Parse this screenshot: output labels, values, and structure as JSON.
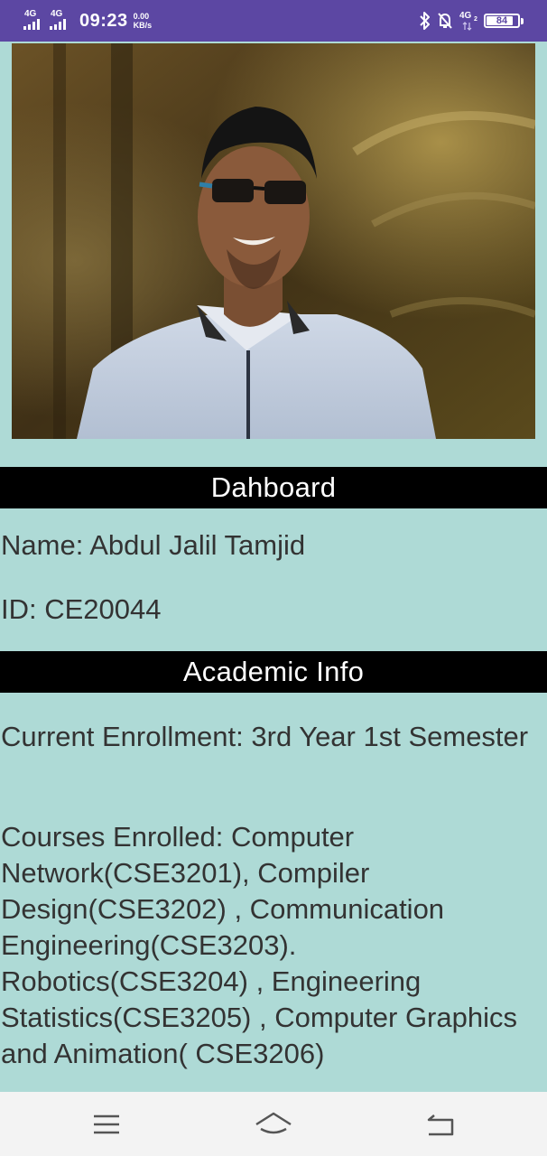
{
  "status_bar": {
    "network_left_1": "4G",
    "network_left_2": "4G",
    "time": "09:23",
    "speed_value": "0.00",
    "speed_unit": "KB/s",
    "network_right": "4G",
    "network_right_sub": "2",
    "battery_level": "84",
    "icons": [
      "signal-icon",
      "bluetooth-icon",
      "mute-notification-icon",
      "battery-icon"
    ]
  },
  "profile_photo": {
    "icon": "profile-photo"
  },
  "dashboard": {
    "title": "Dahboard",
    "name_line": "Name: Abdul Jalil Tamjid",
    "id_line": "ID: CE20044"
  },
  "academic": {
    "title": "Academic Info",
    "enrollment_line": "Current Enrollment: 3rd Year 1st Semester",
    "courses_line": "Courses Enrolled: Computer Network(CSE3201),  Compiler Design(CSE3202) ,  Communication Engineering(CSE3203). Robotics(CSE3204) , Engineering Statistics(CSE3205) ,  Computer Graphics and Animation( CSE3206)"
  },
  "nav_bar": {
    "icons": [
      "menu-icon",
      "home-icon",
      "back-icon"
    ]
  },
  "colors": {
    "status_bar": "#5c47a3",
    "background": "#aedad6",
    "header_bg": "#000000",
    "header_text": "#ffffff",
    "body_text": "#333333",
    "nav_bar": "#f3f3f3"
  }
}
